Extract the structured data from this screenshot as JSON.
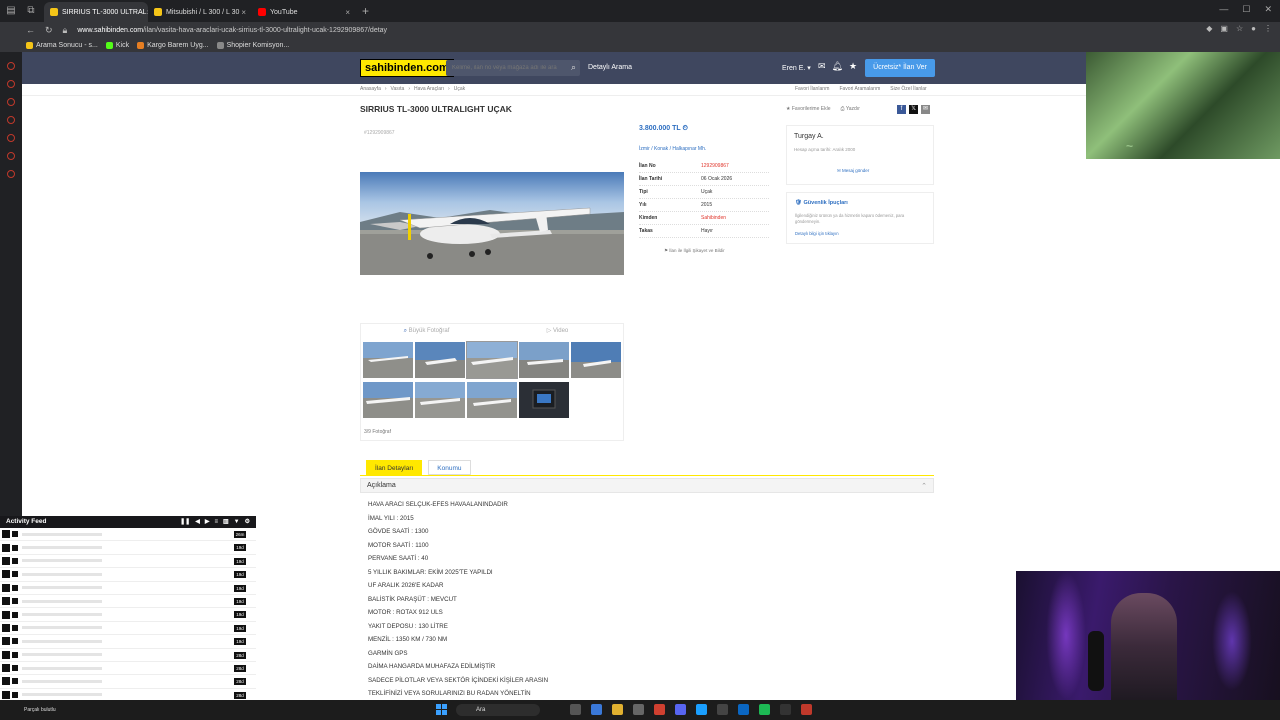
{
  "browser": {
    "tabs": [
      {
        "label": "SIRRIUS TL-3000 ULTRAL",
        "color": "#f5c518",
        "active": true
      },
      {
        "label": "Mitsubishi / L 300 / L 30",
        "color": "#f5c518",
        "active": false
      },
      {
        "label": "YouTube",
        "color": "#ff0000",
        "active": false
      }
    ],
    "url_host": "www.sahibinden.com",
    "url_path": "/ilan/vasita-hava-araclari-ucak-sirrius-tl-3000-ultralight-ucak-1292909867/detay",
    "bookmarks": [
      {
        "label": "Arama Sonucu - s...",
        "color": "#f5c518"
      },
      {
        "label": "Kick",
        "color": "#53fc18"
      },
      {
        "label": "Kargo Barem Uyg...",
        "color": "#e67e22"
      },
      {
        "label": "Shopier Komisyon...",
        "color": "#888888"
      }
    ]
  },
  "site": {
    "logo": "sahibinden.com",
    "search_placeholder": "Kelime, ilan no veya mağaza adı ile ara",
    "advanced_search": "Detaylı Arama",
    "user_menu": "Eren E.",
    "post_ad": "Ücretsiz* İlan Ver",
    "notif_count": "1"
  },
  "breadcrumb": [
    "Anasayfa",
    "Vasıta",
    "Hava Araçları",
    "Uçak"
  ],
  "breadcrumb_right": [
    "Favori İlanlarım",
    "Favori Aramalarım",
    "Size Özel İlanlar"
  ],
  "listing": {
    "title": "SIRRIUS TL-3000 ULTRALIGHT UÇAK",
    "id_small": "#1292909867",
    "actions": [
      "Favorilerime Ekle",
      "Yazdır"
    ],
    "price": "3.800.000 TL",
    "location": "İzmir / Konak / Halkapınar Mh.",
    "details": [
      {
        "k": "İlan No",
        "v": "1292909867",
        "red": true
      },
      {
        "k": "İlan Tarihi",
        "v": "06 Ocak 2026",
        "red": false
      },
      {
        "k": "Tipi",
        "v": "Uçak",
        "red": false
      },
      {
        "k": "Yılı",
        "v": "2015",
        "red": false
      },
      {
        "k": "Kimden",
        "v": "Sahibinden",
        "red": true
      },
      {
        "k": "Takas",
        "v": "Hayır",
        "red": false
      }
    ],
    "report": "İlan ile İlgili Şikayet ve Bildir",
    "photo_tab_big": "Büyük Fotoğraf",
    "photo_tab_video": "Video",
    "photo_count": "3/9 Fotoğraf"
  },
  "seller": {
    "name": "Turgay A.",
    "since": "Hesap açma tarihi: Aralık 2000",
    "message": "Mesaj gönder"
  },
  "safety": {
    "title": "Güvenlik İpuçları",
    "text": "İlgilendiğiniz ürünün ya da hizmetin kaparo ödemeniz, para göndermeyin.",
    "link": "Detaylı bilgi için tıklayın"
  },
  "detail_tabs": [
    "İlan Detayları",
    "Konumu"
  ],
  "description_title": "Açıklama",
  "description": [
    "HAVA ARACI SELÇUK-EFES HAVAALANINDADIR",
    "İMAL YILI  :  2015",
    "GÖVDE SAATİ  :  1300",
    "MOTOR SAATİ  :  1100",
    "PERVANE SAATİ  :  40",
    "5 YILLIK BAKIMLAR:    EKİM 2025'TE YAPILDI",
    "UF  ARALIK 2026'E KADAR",
    "BALİSTİK PARAŞÜT  :  MEVCUT",
    "MOTOR : ROTAX 912 ULS",
    "YAKIT DEPOSU : 130 LİTRE",
    "MENZİL : 1350 KM / 730 NM",
    "GARMİN GPS",
    "DAİMA HANGARDA MUHAFAZA EDİLMİŞTİR",
    "SADECE  PİLOTLAR VEYA SEKTÖR İÇİNDEKİ KİŞİLER ARASIN",
    "TEKLİFİNİZİ VEYA SORULARINIZI BU RADAN YÖNELTİN"
  ],
  "feed": {
    "title": "Activity Feed",
    "times": [
      "26m",
      "19d",
      "19d",
      "19d",
      "19d",
      "19d",
      "19d",
      "19d",
      "19d",
      "28d",
      "28d",
      "28d",
      "28d"
    ]
  },
  "taskbar": {
    "weather": "Parçalı bulutlu",
    "search": "Ara"
  }
}
